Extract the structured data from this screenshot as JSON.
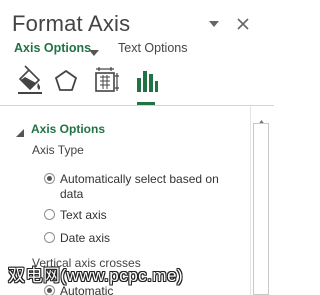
{
  "pane": {
    "title": "Format Axis",
    "colors": {
      "accent": "#217346",
      "text": "#333333",
      "title": "#444444"
    }
  },
  "controls": {
    "task_pane_options_icon": "chevron-down-icon",
    "close_icon": "close-icon"
  },
  "tabs": [
    {
      "label": "Axis Options",
      "active": true
    },
    {
      "label": "Text Options",
      "active": false
    }
  ],
  "icon_tabs": [
    {
      "name": "fill-line-icon",
      "selected": false
    },
    {
      "name": "effects-icon",
      "selected": false
    },
    {
      "name": "size-properties-icon",
      "selected": false
    },
    {
      "name": "axis-options-icon",
      "selected": true
    }
  ],
  "section": {
    "title": "Axis Options",
    "axis_type": {
      "label": "Axis Type",
      "options": [
        {
          "label": "Automatically select based on data",
          "checked": true
        },
        {
          "label": "Text axis",
          "checked": false
        },
        {
          "label": "Date axis",
          "checked": false
        }
      ]
    },
    "vertical_axis_crosses": {
      "label": "Vertical axis crosses",
      "options": [
        {
          "label": "Automatic",
          "checked": true
        }
      ]
    }
  },
  "watermark": "双电网(www.pcpc.me)"
}
